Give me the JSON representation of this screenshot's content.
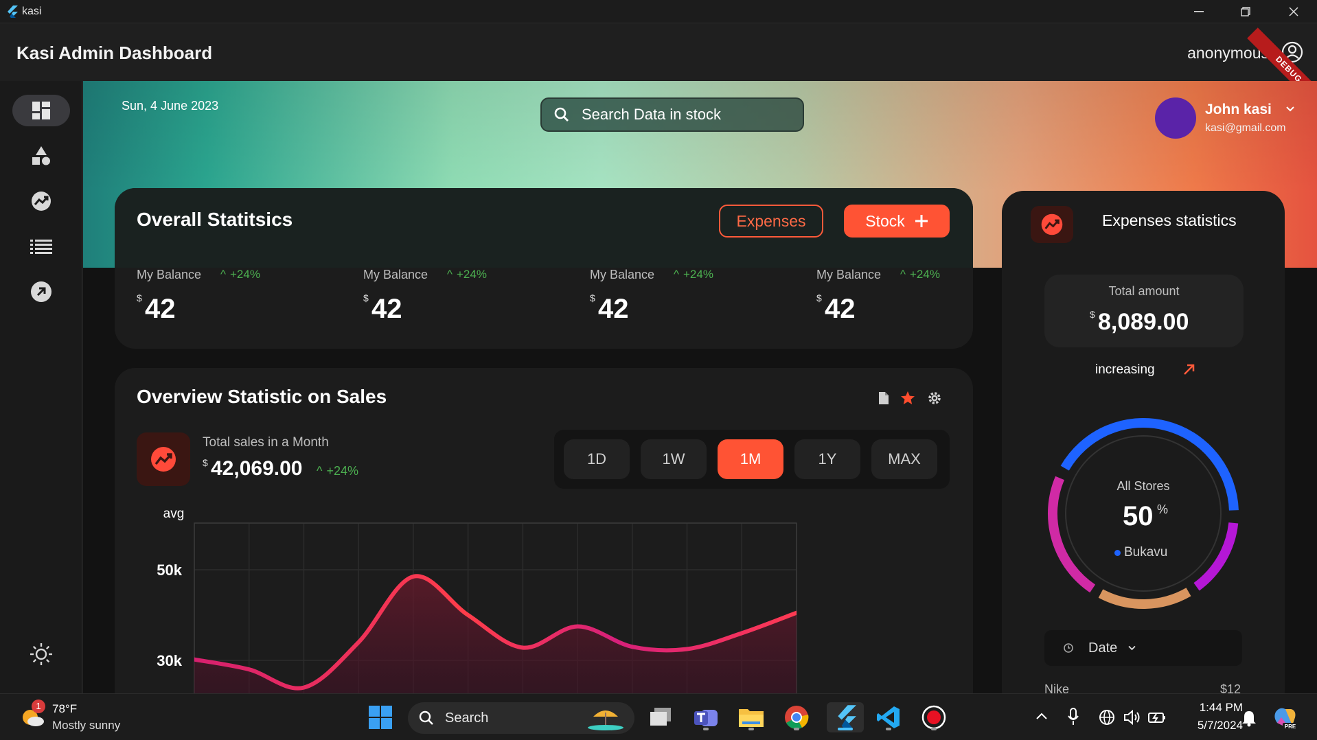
{
  "window": {
    "app_name": "kasi"
  },
  "header": {
    "title": "Kasi Admin Dashboard",
    "user": "anonymous",
    "debug_banner": "DEBUG"
  },
  "banner": {
    "date": "Sun, 4 June 2023",
    "search_placeholder": "Search Data in stock",
    "profile": {
      "name": "John kasi",
      "email": "kasi@gmail.com"
    }
  },
  "sidebar": {
    "items": [
      {
        "icon": "dashboard-icon",
        "active": true
      },
      {
        "icon": "shapes-icon"
      },
      {
        "icon": "trend-chart-icon"
      },
      {
        "icon": "list-icon"
      },
      {
        "icon": "arrow-circle-icon"
      }
    ],
    "bottom_icon": "sun-icon"
  },
  "overall": {
    "title": "Overall Statitsics",
    "expenses_label": "Expenses",
    "stock_label": "Stock",
    "balances": [
      {
        "label": "My Balance",
        "change": "+24%",
        "currency": "$",
        "value": "42"
      },
      {
        "label": "My Balance",
        "change": "+24%",
        "currency": "$",
        "value": "42"
      },
      {
        "label": "My Balance",
        "change": "+24%",
        "currency": "$",
        "value": "42"
      },
      {
        "label": "My Balance",
        "change": "+24%",
        "currency": "$",
        "value": "42"
      }
    ]
  },
  "sales": {
    "title": "Overview Statistic on Sales",
    "total_label": "Total sales in a Month",
    "currency": "$",
    "total_value": "42,069.00",
    "change": "+24%",
    "ranges": [
      "1D",
      "1W",
      "1M",
      "1Y",
      "MAX"
    ],
    "active_range": "1M"
  },
  "chart_data": {
    "type": "area",
    "ylabel": "avg",
    "ytick_labels": [
      "50k",
      "30k"
    ],
    "ylim_visible": [
      30000,
      50000
    ],
    "x": [
      0,
      1,
      2,
      3,
      4,
      5,
      6,
      7,
      8,
      9,
      10,
      11
    ],
    "series": [
      {
        "values": [
          30200,
          28000,
          24000,
          34000,
          48500,
          40000,
          32800,
          37500,
          33000,
          32500,
          36000,
          40500
        ]
      }
    ],
    "grid": true
  },
  "expenses": {
    "title": "Expenses statistics",
    "total_label": "Total amount",
    "currency": "$",
    "total_value": "8,089.00",
    "trend_label": "increasing",
    "gauge": {
      "label": "All Stores",
      "value": "50",
      "unit": "%",
      "store": "Bukavu",
      "percent": 50
    },
    "date_label": "Date",
    "list": [
      {
        "name": "Nike",
        "amount": "$12"
      }
    ]
  },
  "taskbar": {
    "weather": {
      "temp": "78°F",
      "desc": "Mostly sunny",
      "badge": "1"
    },
    "search_label": "Search",
    "time": "1:44 PM",
    "date": "5/7/2024"
  },
  "colors": {
    "accent": "#ff5334",
    "positive": "#4caf50",
    "gauge_blue": "#1e63ff",
    "gauge_purple": "#b517d6",
    "gauge_magenta": "#d02aa5",
    "gauge_tan": "#d9955f"
  }
}
